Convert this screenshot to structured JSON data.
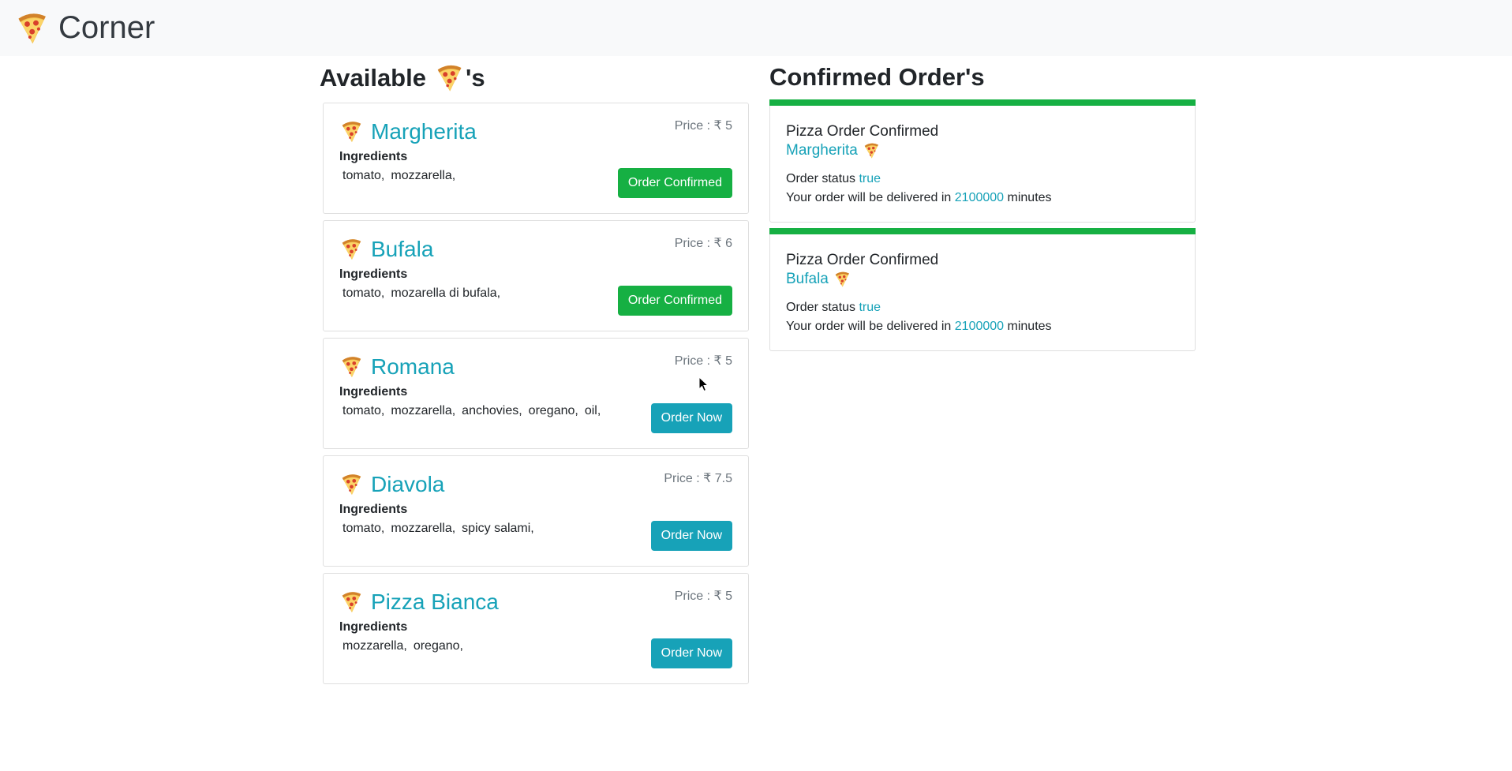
{
  "navbar": {
    "brand": "Corner",
    "brand_icon": "pizza-icon"
  },
  "available": {
    "heading_prefix": "Available",
    "heading_suffix": "'s"
  },
  "confirmed": {
    "heading": "Confirmed Order's"
  },
  "pizzas": [
    {
      "name": "Margherita",
      "price": "Price : ₹ 5",
      "ingredients_label": "Ingredients",
      "ingredients": [
        "tomato,",
        "mozzarella,"
      ],
      "button": "Order Confirmed",
      "confirmed": true
    },
    {
      "name": "Bufala",
      "price": "Price : ₹ 6",
      "ingredients_label": "Ingredients",
      "ingredients": [
        "tomato,",
        "mozarella di bufala,"
      ],
      "button": "Order Confirmed",
      "confirmed": true
    },
    {
      "name": "Romana",
      "price": "Price : ₹ 5",
      "ingredients_label": "Ingredients",
      "ingredients": [
        "tomato,",
        "mozzarella,",
        "anchovies,",
        "oregano,",
        "oil,"
      ],
      "button": "Order Now",
      "confirmed": false
    },
    {
      "name": "Diavola",
      "price": "Price : ₹ 7.5",
      "ingredients_label": "Ingredients",
      "ingredients": [
        "tomato,",
        "mozzarella,",
        "spicy salami,"
      ],
      "button": "Order Now",
      "confirmed": false
    },
    {
      "name": "Pizza Bianca",
      "price": "Price : ₹ 5",
      "ingredients_label": "Ingredients",
      "ingredients": [
        "mozzarella,",
        "oregano,"
      ],
      "button": "Order Now",
      "confirmed": false
    }
  ],
  "orders": [
    {
      "title": "Pizza Order Confirmed",
      "pizza": "Margherita",
      "status_label": "Order status",
      "status_value": "true",
      "deliver_prefix": "Your order will be delivered in",
      "deliver_value": "2100000",
      "deliver_suffix": "minutes"
    },
    {
      "title": "Pizza Order Confirmed",
      "pizza": "Bufala",
      "status_label": "Order status",
      "status_value": "true",
      "deliver_prefix": "Your order will be delivered in",
      "deliver_value": "2100000",
      "deliver_suffix": "minutes"
    }
  ],
  "colors": {
    "accent": "#17a2b8",
    "success": "#16b043",
    "navbar_bg": "#f8f9fa"
  }
}
